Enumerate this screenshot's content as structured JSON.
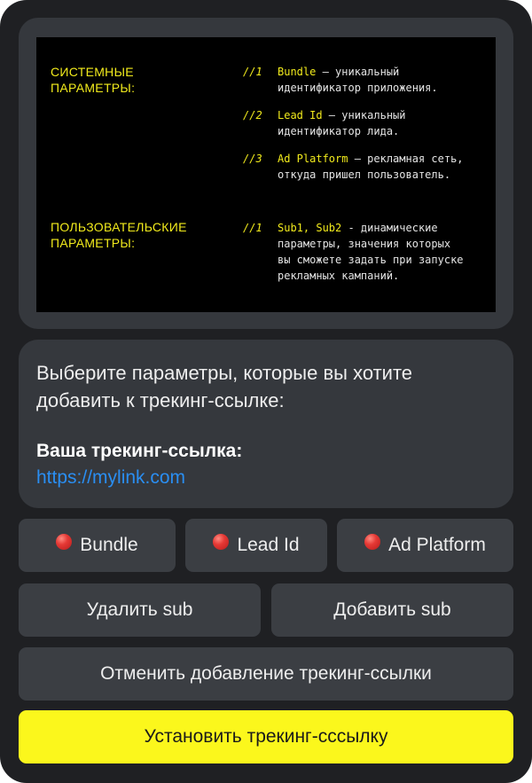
{
  "info": {
    "system_heading": [
      "СИСТЕМНЫЕ",
      "ПАРАМЕТРЫ:"
    ],
    "system_items": [
      {
        "num": "//1",
        "keyword": "Bundle",
        "text": [
          " — уникальный",
          "идентификатор приложения."
        ]
      },
      {
        "num": "//2",
        "keyword": "Lead Id",
        "text": [
          " — уникальный",
          "идентификатор лида."
        ]
      },
      {
        "num": "//3",
        "keyword": "Ad Platform",
        "text": [
          " — рекламная сеть,",
          "откуда пришел пользователь."
        ]
      }
    ],
    "user_heading": [
      "ПОЛЬЗОВАТЕЛЬСКИЕ",
      "ПАРАМЕТРЫ:"
    ],
    "user_items": [
      {
        "num": "//1",
        "keyword": "Sub1, Sub2",
        "text": [
          " - динамические",
          "параметры, значения которых",
          "вы сможете задать при запуске",
          "рекламных кампаний."
        ]
      }
    ]
  },
  "message": {
    "prompt": "Выберите параметры, которые вы хотите добавить к трекинг-ссылке:",
    "link_label": "Ваша трекинг-ссылка:",
    "link": "https://mylink.com"
  },
  "buttons": {
    "bundle": "Bundle",
    "lead_id": "Lead Id",
    "ad_platform": "Ad Platform",
    "remove_sub": "Удалить sub",
    "add_sub": "Добавить sub",
    "cancel": "Отменить добавление трекинг-ссылки",
    "install": "Установить трекинг-сссылку"
  },
  "colors": {
    "accent": "#fbf71c",
    "link": "#2a8ef2",
    "status_dot": "#e53935",
    "background": "#1f2023"
  },
  "icons": {
    "param_status": "red-circle-icon"
  }
}
